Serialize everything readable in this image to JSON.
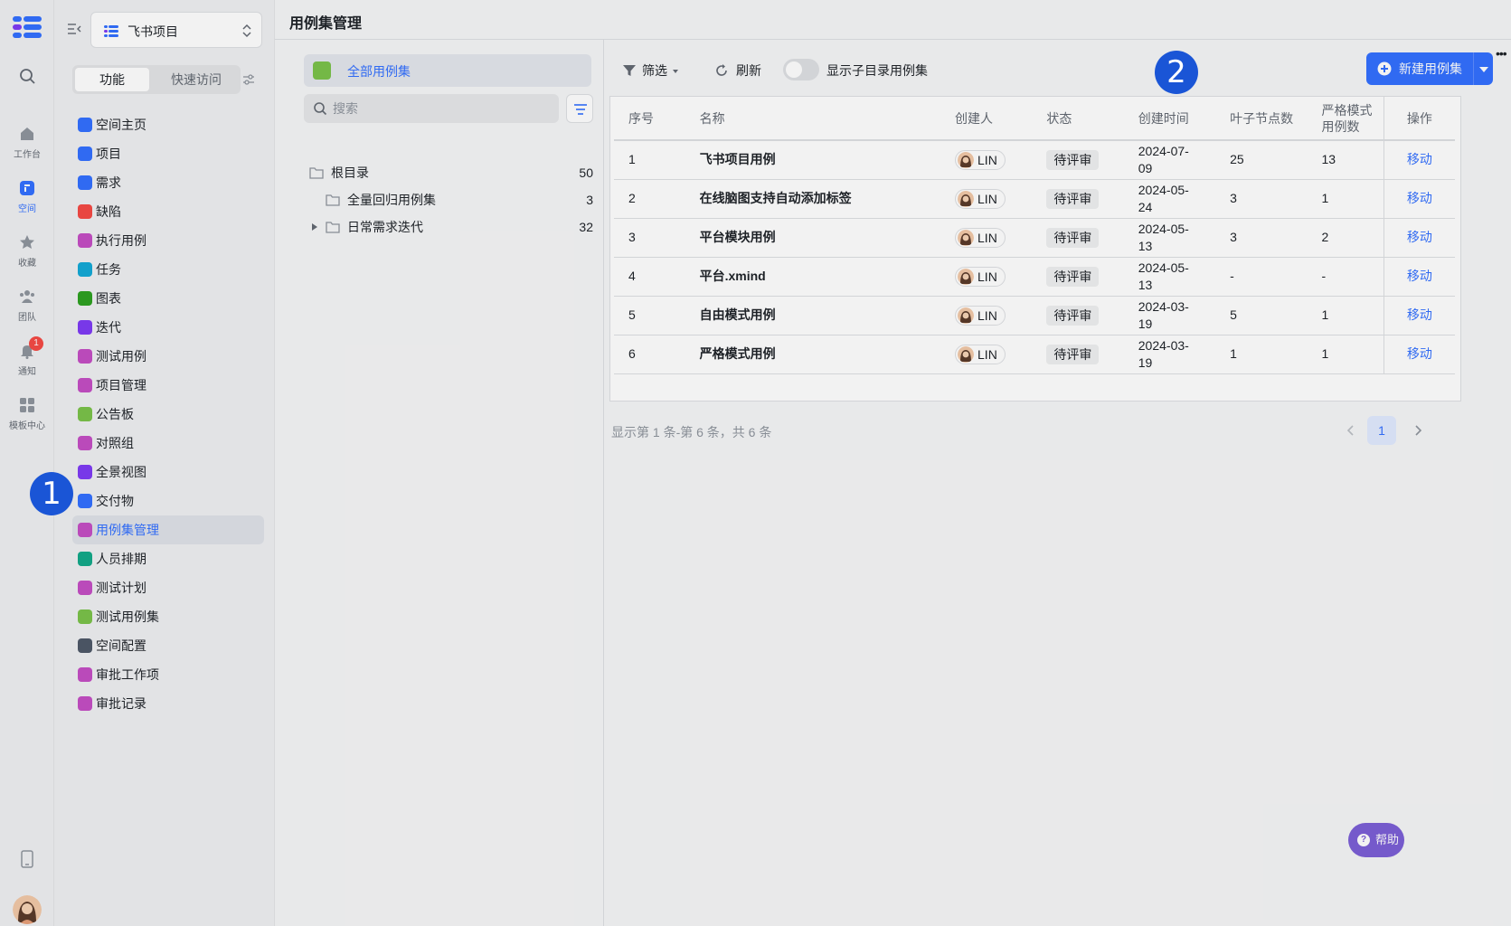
{
  "rail": {
    "items": [
      {
        "label": "工作台",
        "icon": "home-icon"
      },
      {
        "label": "空间",
        "icon": "space-icon"
      },
      {
        "label": "收藏",
        "icon": "star-icon"
      },
      {
        "label": "团队",
        "icon": "team-icon"
      },
      {
        "label": "通知",
        "icon": "bell-icon",
        "badge": "1"
      },
      {
        "label": "模板中心",
        "icon": "template-icon"
      }
    ]
  },
  "nav": {
    "space_name": "飞书项目",
    "seg_function": "功能",
    "seg_quick": "快速访问",
    "items": [
      {
        "label": "空间主页",
        "color": "#3370ff"
      },
      {
        "label": "项目",
        "color": "#3370ff"
      },
      {
        "label": "需求",
        "color": "#3370ff"
      },
      {
        "label": "缺陷",
        "color": "#f54a45"
      },
      {
        "label": "执行用例",
        "color": "#c44fc4"
      },
      {
        "label": "任务",
        "color": "#14a9d6"
      },
      {
        "label": "图表",
        "color": "#2ea121"
      },
      {
        "label": "迭代",
        "color": "#7f3bf5"
      },
      {
        "label": "测试用例",
        "color": "#c44fc4"
      },
      {
        "label": "项目管理",
        "color": "#c44fc4"
      },
      {
        "label": "公告板",
        "color": "#7bc24a"
      },
      {
        "label": "对照组",
        "color": "#c44fc4"
      },
      {
        "label": "全景视图",
        "color": "#7f3bf5"
      },
      {
        "label": "交付物",
        "color": "#3370ff"
      },
      {
        "label": "用例集管理",
        "color": "#c44fc4",
        "active": true
      },
      {
        "label": "人员排期",
        "color": "#14a98a"
      },
      {
        "label": "测试计划",
        "color": "#c44fc4"
      },
      {
        "label": "测试用例集",
        "color": "#7bc24a"
      },
      {
        "label": "空间配置",
        "color": "#4e5969"
      },
      {
        "label": "审批工作项",
        "color": "#c44fc4"
      },
      {
        "label": "审批记录",
        "color": "#c44fc4"
      }
    ]
  },
  "page": {
    "title": "用例集管理"
  },
  "tree": {
    "all_label": "全部用例集",
    "search_placeholder": "搜索",
    "rows": [
      {
        "label": "根目录",
        "count": "50"
      },
      {
        "label": "全量回归用例集",
        "count": "3"
      },
      {
        "label": "日常需求迭代",
        "count": "32"
      }
    ]
  },
  "toolbar": {
    "filter": "筛选",
    "refresh": "刷新",
    "toggle_label": "显示子目录用例集",
    "new_button": "新建用例集"
  },
  "table": {
    "headers": [
      "序号",
      "名称",
      "创建人",
      "状态",
      "创建时间",
      "叶子节点数",
      "严格模式用例数",
      "操作"
    ],
    "rows": [
      {
        "no": "1",
        "name": "飞书项目用例",
        "creator": "LIN",
        "status": "待评审",
        "created": "2024-07-09",
        "leaf": "25",
        "strict": "13",
        "op": "移动"
      },
      {
        "no": "2",
        "name": "在线脑图支持自动添加标签",
        "creator": "LIN",
        "status": "待评审",
        "created": "2024-05-24",
        "leaf": "3",
        "strict": "1",
        "op": "移动"
      },
      {
        "no": "3",
        "name": "平台模块用例",
        "creator": "LIN",
        "status": "待评审",
        "created": "2024-05-13",
        "leaf": "3",
        "strict": "2",
        "op": "移动"
      },
      {
        "no": "4",
        "name": "平台.xmind",
        "creator": "LIN",
        "status": "待评审",
        "created": "2024-05-13",
        "leaf": "-",
        "strict": "-",
        "op": "移动"
      },
      {
        "no": "5",
        "name": "自由模式用例",
        "creator": "LIN",
        "status": "待评审",
        "created": "2024-03-19",
        "leaf": "5",
        "strict": "1",
        "op": "移动"
      },
      {
        "no": "6",
        "name": "严格模式用例",
        "creator": "LIN",
        "status": "待评审",
        "created": "2024-03-19",
        "leaf": "1",
        "strict": "1",
        "op": "移动"
      }
    ]
  },
  "pager": {
    "info": "显示第 1 条-第 6 条，共 6 条",
    "current": "1"
  },
  "help": {
    "label": "帮助"
  },
  "callouts": [
    "1",
    "2"
  ]
}
